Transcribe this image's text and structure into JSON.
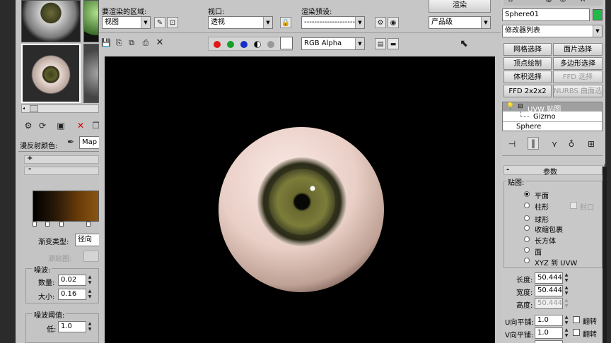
{
  "top": {
    "region_label": "要渲染的区域:",
    "region_value": "视图",
    "viewport_label": "视口:",
    "viewport_value": "透视",
    "preset_label": "渲染预设:",
    "preset_value": "----------------------------",
    "render_button": "渲染",
    "quality_value": "产品级",
    "channel_value": "RGB Alpha"
  },
  "left": {
    "diffuse_label": "漫反射颜色:",
    "map_label": "Map",
    "plus": "+",
    "minus": "-",
    "gradient_type_label": "渐变类型:",
    "gradient_type_value": "径向",
    "source_map_label": "源贴图:",
    "noise_label": "噪波:",
    "amount_label": "数量:",
    "amount_value": "0.02",
    "size_label": "大小:",
    "size_value": "0.16",
    "noise_threshold_label": "噪波阈值:",
    "low_label": "低:",
    "low_value": "1.0"
  },
  "right": {
    "object_name": "Sphere01",
    "modifier_list": "修改器列表",
    "buttons": [
      "网格选择",
      "面片选择",
      "顶点绘制",
      "多边形选择",
      "体积选择",
      "FFD 选择",
      "FFD 2x2x2",
      "NURBS 曲面选择"
    ],
    "stack": {
      "uvw": "UVW 贴图",
      "gizmo": "Gizmo",
      "sphere": "Sphere"
    },
    "rollout_title": "参数",
    "mapping_label": "贴图:",
    "mapping_options": [
      "平面",
      "柱形",
      "球形",
      "收缩包裹",
      "长方体",
      "面",
      "XYZ 到 UVW"
    ],
    "cap_label": "封口",
    "length_label": "长度:",
    "length_value": "50.444",
    "width_label": "宽度:",
    "width_value": "50.444",
    "height_label": "高度:",
    "height_value": "50.444",
    "u_tile_label": "U向平铺:",
    "u_tile_value": "1.0",
    "v_tile_label": "V向平铺:",
    "v_tile_value": "1.0",
    "flip_label": "翻转"
  },
  "colors": {
    "accent_green": "#22b84a",
    "bg_gray": "#c8c8c8"
  }
}
